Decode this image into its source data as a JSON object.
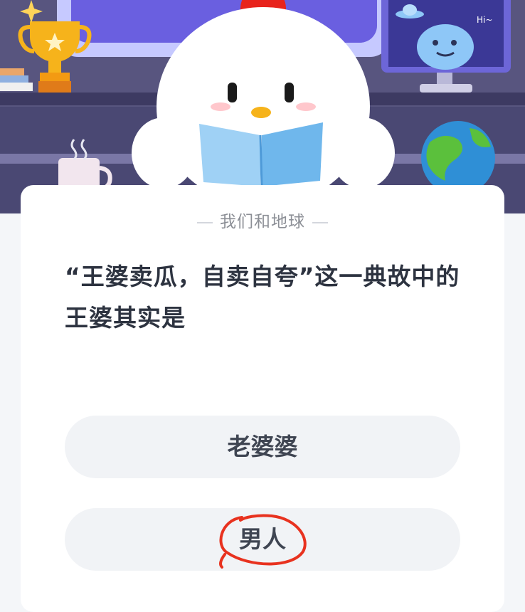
{
  "quiz": {
    "category": "我们和地球",
    "question": "“王婆卖瓜，自卖自夸”这一典故中的王婆其实是",
    "options": [
      {
        "label": "老婆婆"
      },
      {
        "label": "男人"
      }
    ]
  },
  "scene": {
    "alien_speech": "Hi~"
  },
  "colors": {
    "scene_bg": "#5a5781",
    "screen_purple": "#6a5fe0",
    "card_bg": "#ffffff",
    "option_bg": "#f1f3f6",
    "annotation_red": "#e8321f"
  }
}
